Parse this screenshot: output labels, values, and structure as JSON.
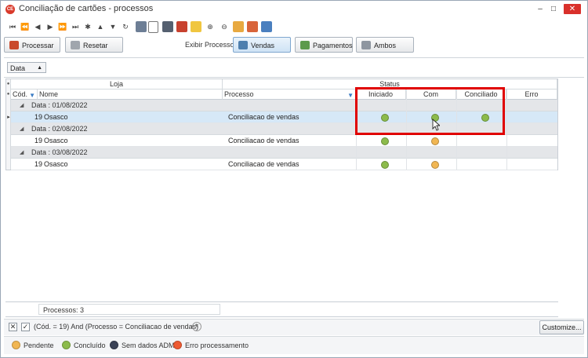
{
  "window": {
    "title": "Conciliação de cartões - processos",
    "app_icon_text": "CE",
    "controls": {
      "minimize": "–",
      "maximize": "□",
      "close": "✕"
    }
  },
  "toolbar": {
    "nav": [
      "⏮",
      "⏪",
      "◀",
      "▶",
      "⏩",
      "⏭",
      "✱",
      "▲",
      "▼",
      "↻"
    ],
    "tools": [
      "folder-icon",
      "document-icon",
      "print-icon",
      "pdf-icon",
      "email-icon",
      "zoom-in-icon",
      "zoom-out-icon",
      "report-icon",
      "grid-icon",
      "export-icon"
    ]
  },
  "process_bar": {
    "processar_label": "Processar",
    "resetar_label": "Resetar",
    "exibir_label": "Exibir Processo:",
    "tabs": [
      {
        "label": "Vendas",
        "active": true
      },
      {
        "label": "Pagamentos",
        "active": false
      },
      {
        "label": "Ambos",
        "active": false
      }
    ]
  },
  "group_by": {
    "label": "Data",
    "arrow": "▲"
  },
  "grid": {
    "bands": {
      "loja": "Loja",
      "status": "Status"
    },
    "columns": {
      "cod": "Cód.",
      "nome": "Nome",
      "processo": "Processo",
      "iniciado": "Iniciado",
      "com_pendencias": "Com pendências",
      "conciliado": "Conciliado",
      "erro": "Erro"
    },
    "groups": [
      {
        "label": "Data : 01/08/2022",
        "row": {
          "cod": "19",
          "nome": "Osasco",
          "processo": "Conciliacao de vendas",
          "iniciado": "concluido",
          "com_pendencias": "concluido",
          "conciliado": "concluido",
          "erro": "",
          "selected": true
        }
      },
      {
        "label": "Data : 02/08/2022",
        "row": {
          "cod": "19",
          "nome": "Osasco",
          "processo": "Conciliacao de vendas",
          "iniciado": "concluido",
          "com_pendencias": "pendente",
          "conciliado": "",
          "erro": "",
          "selected": false
        }
      },
      {
        "label": "Data : 03/08/2022",
        "row": {
          "cod": "19",
          "nome": "Osasco",
          "processo": "Conciliacao de vendas",
          "iniciado": "concluido",
          "com_pendencias": "pendente",
          "conciliado": "",
          "erro": "",
          "selected": false
        }
      }
    ]
  },
  "summary": {
    "text": "Processos: 3"
  },
  "filter": {
    "expression": "(Cód. = 19) And (Processo = Conciliacao de vendas)",
    "customize_label": "Customize..."
  },
  "legend": [
    {
      "label": "Pendente",
      "color": "#f1b652"
    },
    {
      "label": "Concluído",
      "color": "#8cbb4b"
    },
    {
      "label": "Sem dados ADM",
      "color": "#3b4257"
    },
    {
      "label": "Erro processamento",
      "color": "#ee5a32"
    }
  ],
  "status_colors": {
    "concluido": "#8cbb4b",
    "pendente": "#f1b652",
    "sem_dados": "#3b4257",
    "erro": "#ee5a32"
  },
  "highlight_color": "#e00000"
}
